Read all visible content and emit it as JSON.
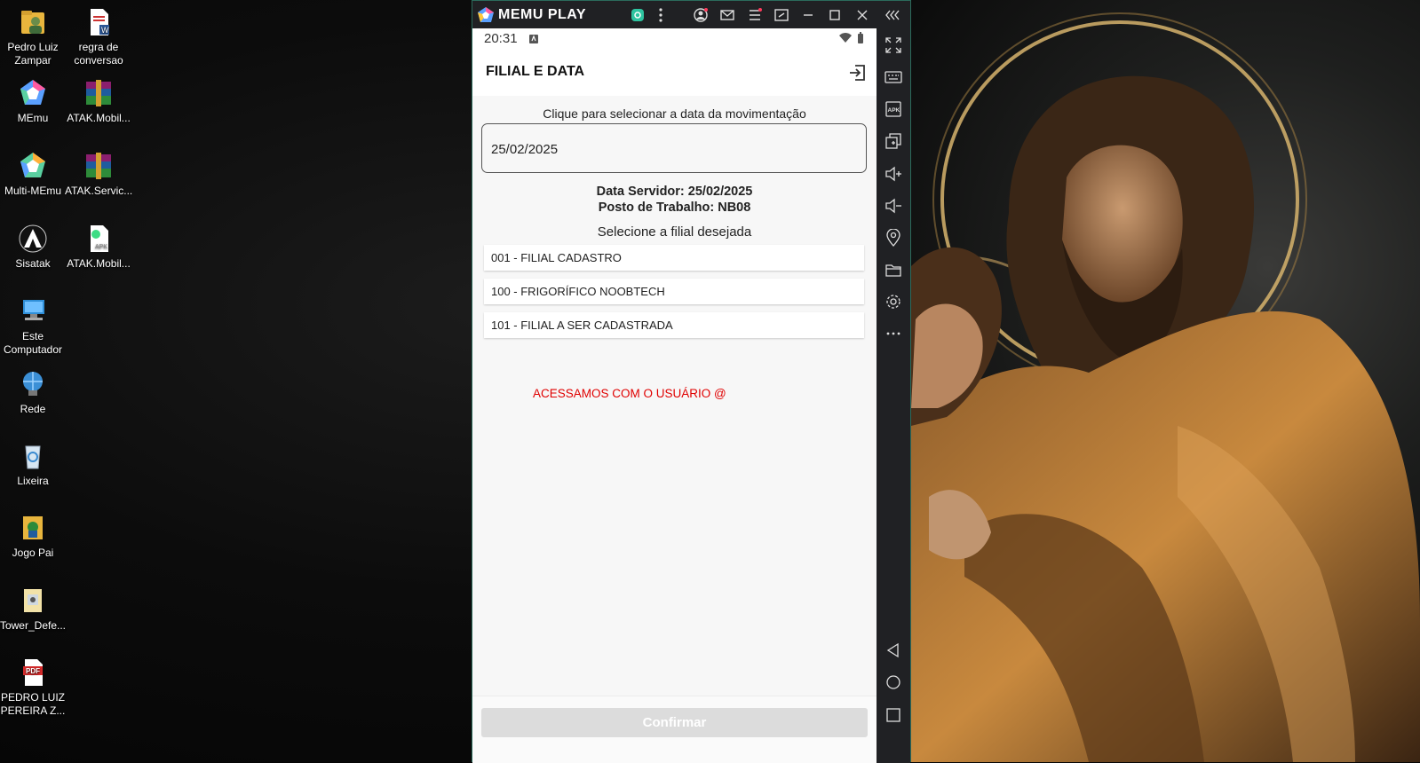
{
  "desktop": {
    "icons": [
      {
        "label": "Pedro Luiz Zampar",
        "icon": "user-folder-icon"
      },
      {
        "label": "regra de conversao",
        "icon": "word-document-icon"
      },
      {
        "label": "MEmu",
        "icon": "memu-app-icon"
      },
      {
        "label": "ATAK.Mobil...",
        "icon": "winrar-archive-icon"
      },
      {
        "label": "Multi-MEmu",
        "icon": "multi-memu-app-icon"
      },
      {
        "label": "ATAK.Servic...",
        "icon": "winrar-archive-icon"
      },
      {
        "label": "Sisatak",
        "icon": "sisatak-app-icon"
      },
      {
        "label": "ATAK.Mobil...",
        "icon": "apk-file-icon"
      },
      {
        "label": "Este Computador",
        "icon": "computer-icon"
      },
      {
        "label": "Rede",
        "icon": "network-icon"
      },
      {
        "label": "Lixeira",
        "icon": "recycle-bin-icon"
      },
      {
        "label": "Jogo Pai",
        "icon": "game-folder-icon"
      },
      {
        "label": "Tower_Defe...",
        "icon": "file-icon"
      },
      {
        "label": "PEDRO LUIZ PEREIRA Z...",
        "icon": "pdf-file-icon"
      }
    ]
  },
  "emulator": {
    "app_name": "MEMU PLAY",
    "sidebar_icons": [
      "fullscreen-icon",
      "keyboard-icon",
      "apk-install-icon",
      "multi-window-icon",
      "volume-up-icon",
      "volume-down-icon",
      "location-icon",
      "folder-icon",
      "settings-icon",
      "more-icon",
      "back-icon",
      "home-icon",
      "recents-icon"
    ]
  },
  "phone": {
    "status": {
      "time": "20:31"
    },
    "appbar": {
      "title": "FILIAL E DATA"
    },
    "date_prompt": "Clique para selecionar a data da movimentação",
    "date_value": "25/02/2025",
    "server_date": "Data Servidor: 25/02/2025",
    "workstation": "Posto de Trabalho: NB08",
    "select_prompt": "Selecione a filial desejada",
    "branches": [
      "001 - FILIAL CADASTRO",
      "100 - FRIGORÍFICO NOOBTECH",
      "101 - FILIAL A SER CADASTRADA"
    ],
    "note": "ACESSAMOS COM O USUÁRIO @",
    "confirm_label": "Confirmar"
  },
  "colors": {
    "accent_note": "#e00000",
    "confirm_disabled": "#dcdcdc"
  }
}
